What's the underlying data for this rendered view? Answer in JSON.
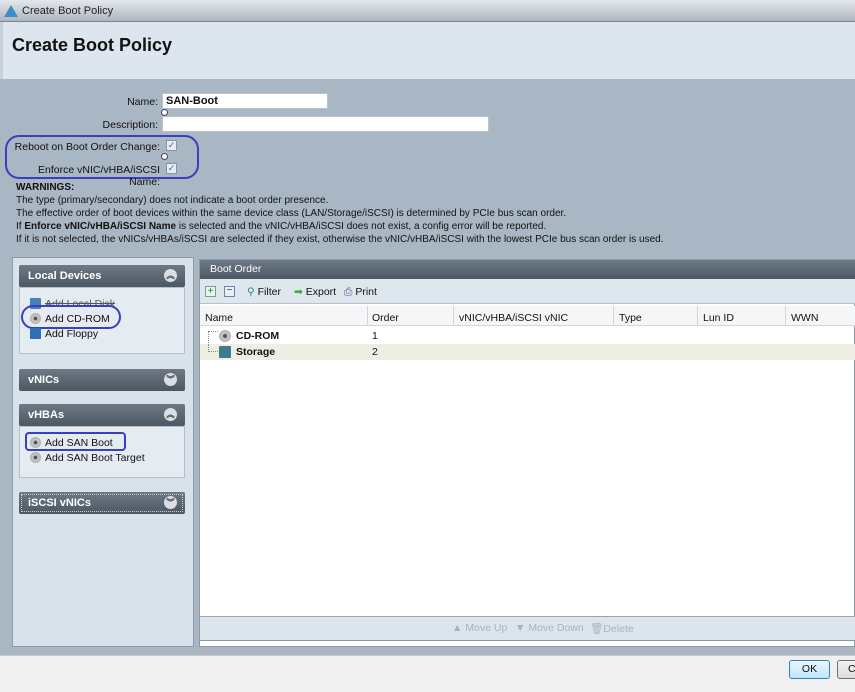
{
  "window": {
    "title": "Create Boot Policy"
  },
  "header": {
    "title": "Create Boot Policy"
  },
  "form": {
    "name_label": "Name:",
    "name_value": "SAN-Boot",
    "description_label": "Description:",
    "description_value": "",
    "reboot_label": "Reboot on Boot Order Change:",
    "reboot_checked": true,
    "enforce_label": "Enforce vNIC/vHBA/iSCSI Name:",
    "enforce_checked": true,
    "check_mark": "✓"
  },
  "warnings": {
    "title": "WARNINGS:",
    "line1": "The type (primary/secondary) does not indicate a boot order presence.",
    "line2": "The effective order of boot devices within the same device class (LAN/Storage/iSCSI) is determined by PCIe bus scan order.",
    "line3_pre": "If ",
    "line3_bold": "Enforce vNIC/vHBA/iSCSI Name",
    "line3_post": " is selected and the vNIC/vHBA/iSCSI does not exist, a config error will be reported.",
    "line4": "If it is not selected, the vNICs/vHBAs/iSCSI are selected if they exist, otherwise the vNIC/vHBA/iSCSI with the lowest PCIe bus scan order is used."
  },
  "left": {
    "local_devices": {
      "title": "Local Devices",
      "items": [
        "Add Local Disk",
        "Add CD-ROM",
        "Add Floppy"
      ]
    },
    "vnics": {
      "title": "vNICs"
    },
    "vhbas": {
      "title": "vHBAs",
      "items": [
        "Add SAN Boot",
        "Add SAN Boot Target"
      ]
    },
    "iscsi": {
      "title": "iSCSI vNICs"
    }
  },
  "boot_order": {
    "title": "Boot Order",
    "toolbar": {
      "filter": "Filter",
      "export": "Export",
      "print": "Print"
    },
    "columns": [
      "Name",
      "Order",
      "vNIC/vHBA/iSCSI vNIC",
      "Type",
      "Lun ID",
      "WWN"
    ],
    "rows": [
      {
        "name": "CD-ROM",
        "order": "1"
      },
      {
        "name": "Storage",
        "order": "2"
      }
    ],
    "footer": {
      "move_up": "Move Up",
      "move_down": "Move Down",
      "delete": "Delete"
    }
  },
  "buttons": {
    "ok": "OK",
    "cancel": "Cancel"
  }
}
